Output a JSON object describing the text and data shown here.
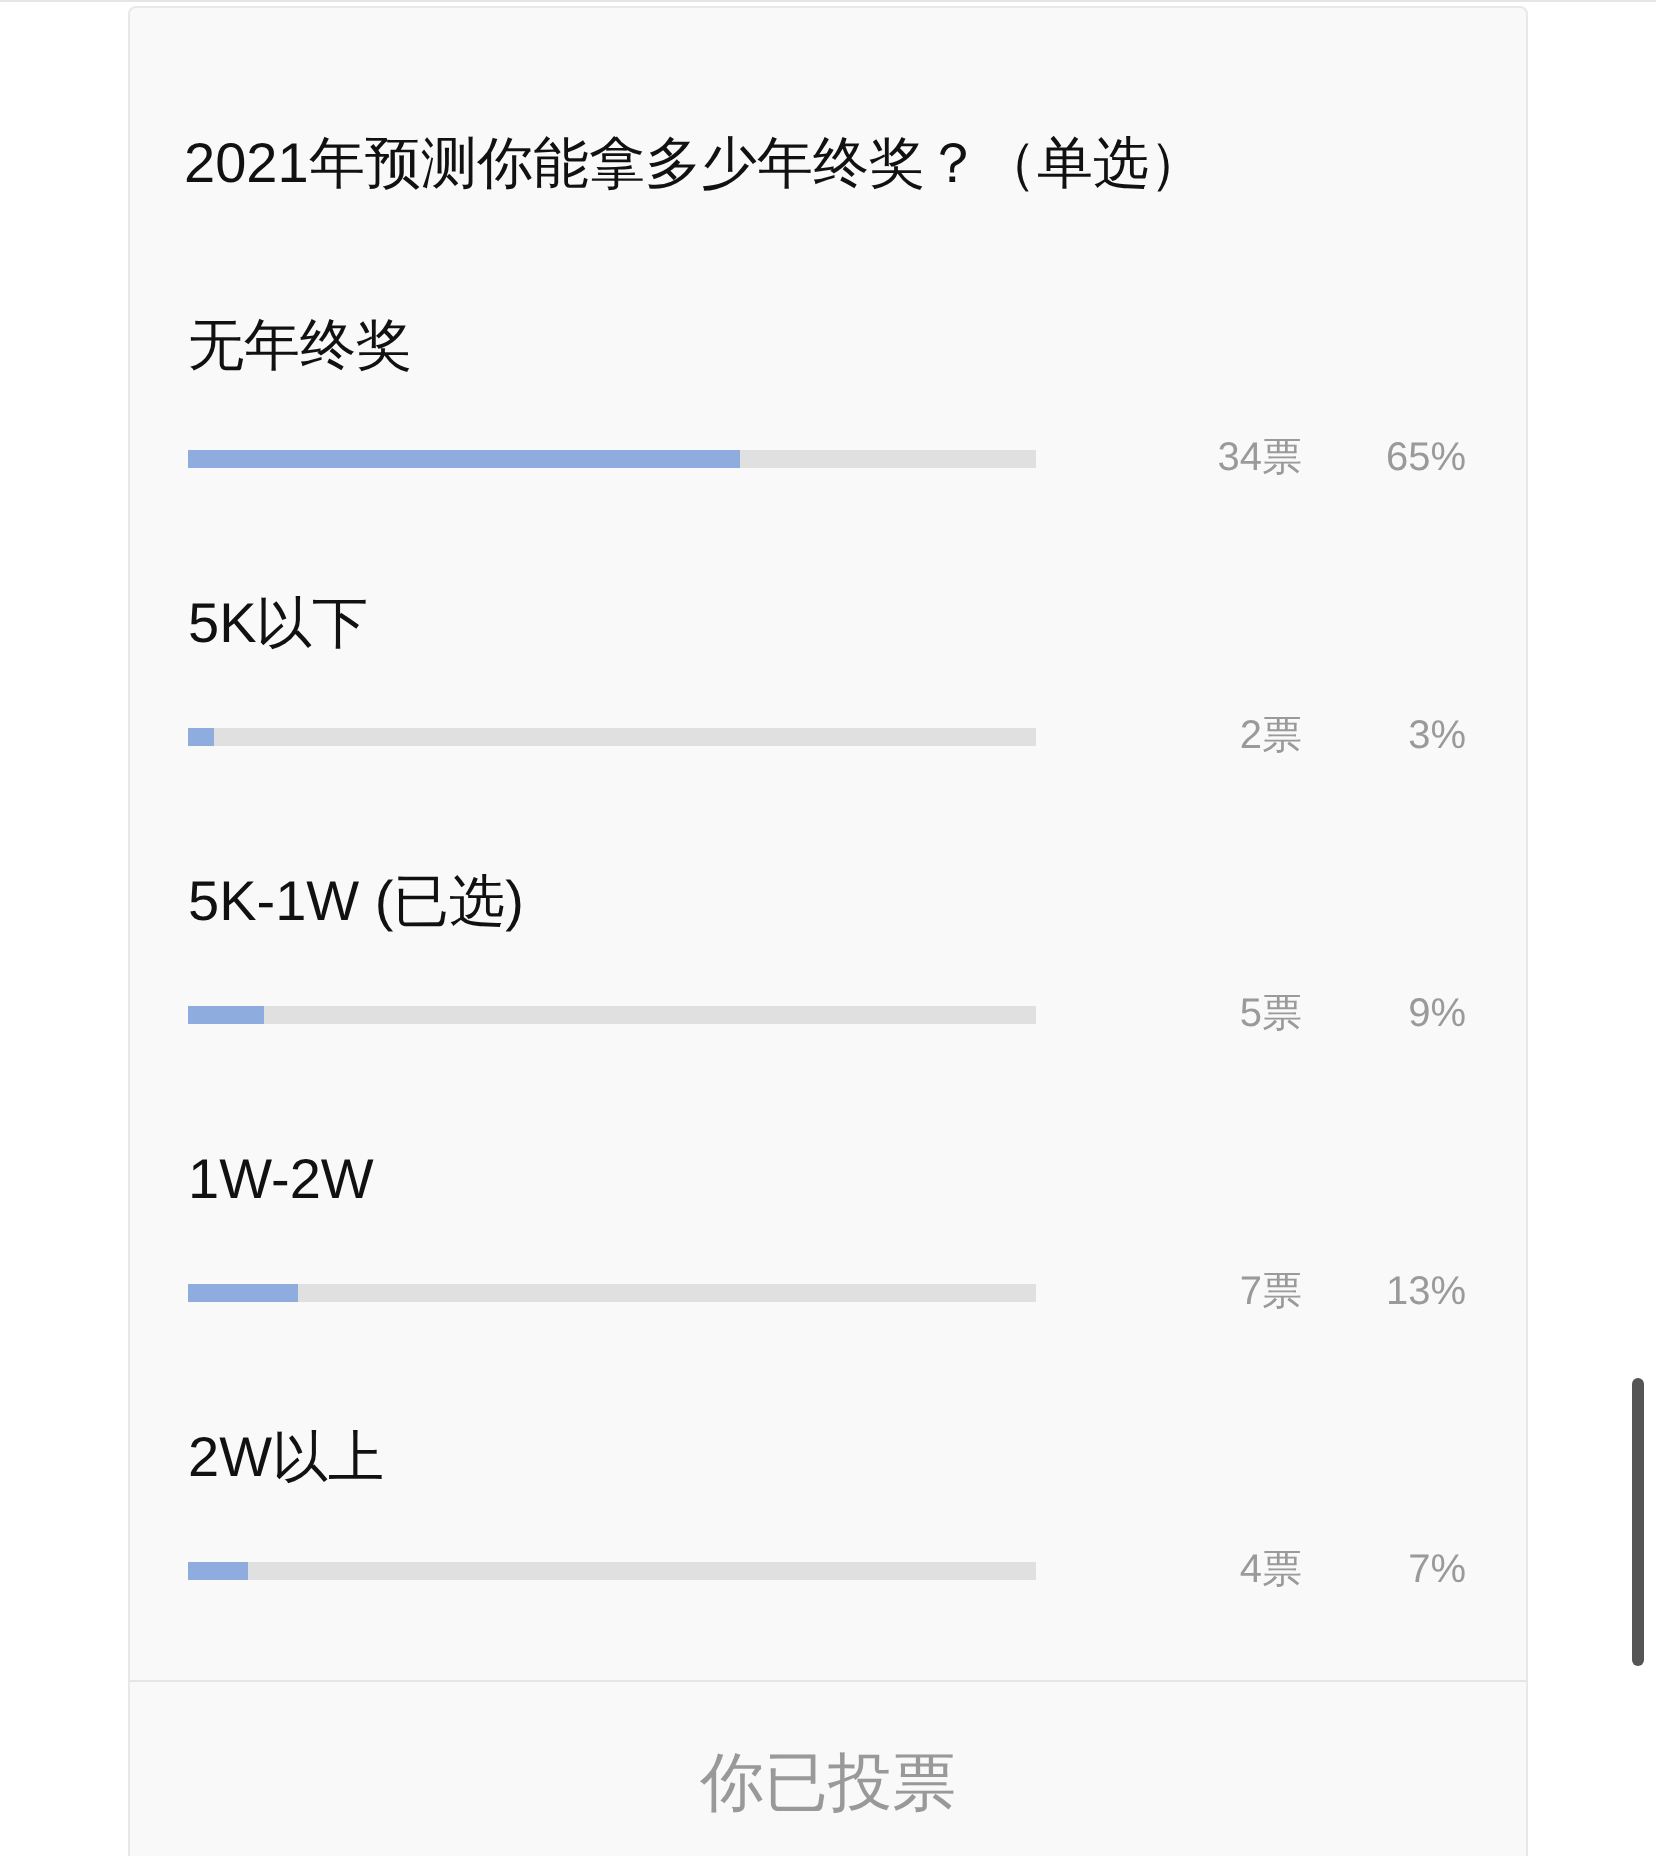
{
  "poll": {
    "title": "2021年预测你能拿多少年终奖？（单选）",
    "options": [
      {
        "label": "无年终奖",
        "level": 0.65,
        "votes": "34票",
        "percent": "65%"
      },
      {
        "label": "5K以下",
        "level": 0.03,
        "votes": "2票",
        "percent": "3%"
      },
      {
        "label": "5K-1W (已选)",
        "level": 0.09,
        "votes": "5票",
        "percent": "9%"
      },
      {
        "label": "1W-2W",
        "level": 0.13,
        "votes": "7票",
        "percent": "13%"
      },
      {
        "label": "2W以上",
        "level": 0.07,
        "votes": "4票",
        "percent": "7%"
      }
    ],
    "footer": "你已投票"
  }
}
